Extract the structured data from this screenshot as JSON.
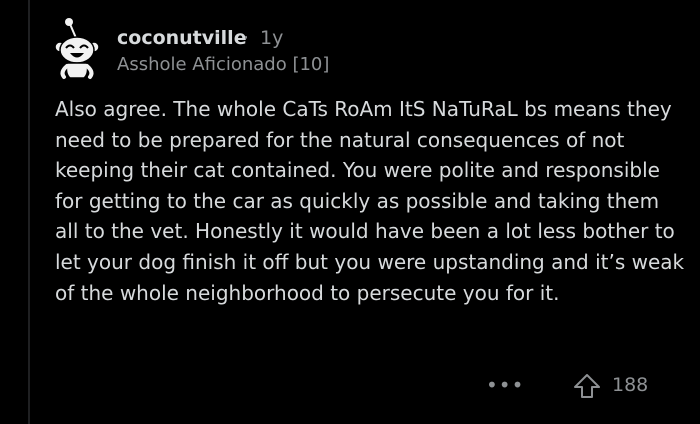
{
  "comment": {
    "username": "coconutville",
    "separator": "·",
    "age": "1y",
    "flair": "Asshole Aficionado [10]",
    "avatar_icon": "reddit-snoo-avatar-icon",
    "body": [
      "Also agree. The whole CaTs RoAm ItS NaTuRaL bs means they need to be prepared for the natural consequences of not keeping their cat contained. You were polite and responsible for getting to the car as quickly as possible and taking them all to the vet. Honestly it would have been a lot less bother to let your dog finish it off but you were upstanding and it’s weak of the whole neighborhood to persecute you for it."
    ],
    "actions": {
      "more_label": "•••",
      "upvote_icon": "upvote-arrow-icon",
      "score": "188"
    }
  },
  "colors": {
    "background": "#000000",
    "text": "#d7dadc",
    "muted": "#8e9194",
    "thread_line": "#1f2022"
  }
}
